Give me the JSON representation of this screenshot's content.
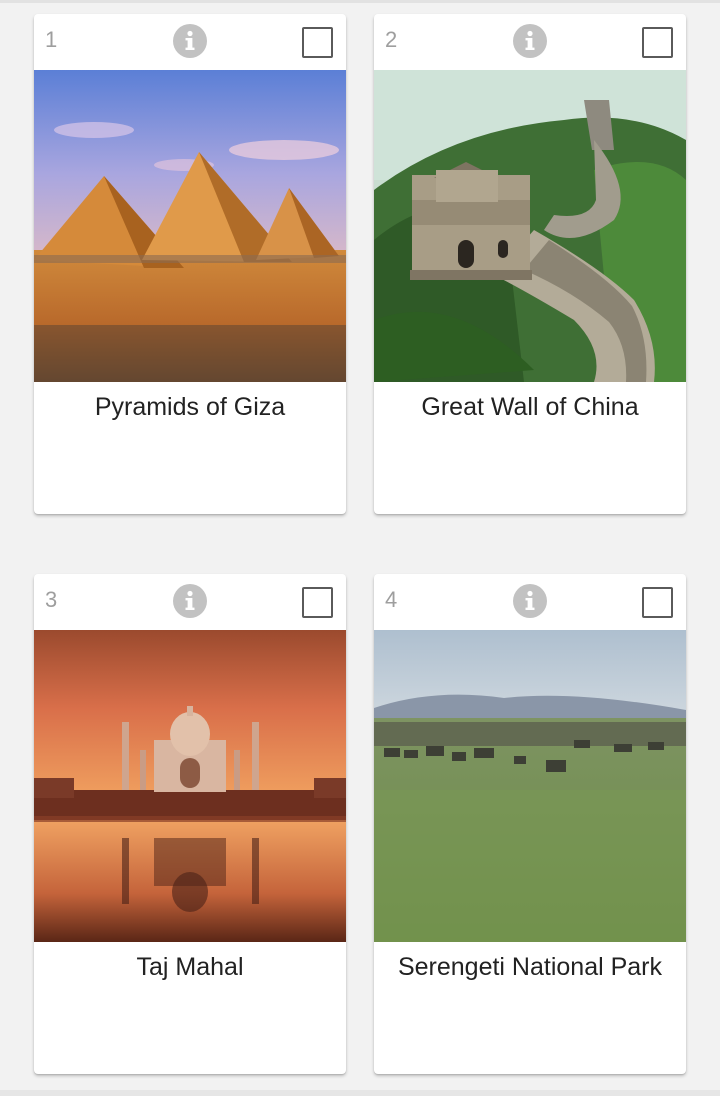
{
  "cards": [
    {
      "number": "1",
      "title": "Pyramids of Giza",
      "image": "pyramids-image",
      "selected": false
    },
    {
      "number": "2",
      "title": "Great Wall of China",
      "image": "great-wall-image",
      "selected": false
    },
    {
      "number": "3",
      "title": "Taj Mahal",
      "image": "taj-mahal-image",
      "selected": false
    },
    {
      "number": "4",
      "title": "Serengeti National Park",
      "image": "serengeti-image",
      "selected": false
    }
  ],
  "icons": {
    "info": "info-icon",
    "checkbox": "checkbox-icon"
  },
  "colors": {
    "background": "#f2f2f2",
    "card": "#ffffff",
    "number_text": "#9e9e9e",
    "info_icon": "#c2c2c2",
    "title_text": "#222222"
  }
}
